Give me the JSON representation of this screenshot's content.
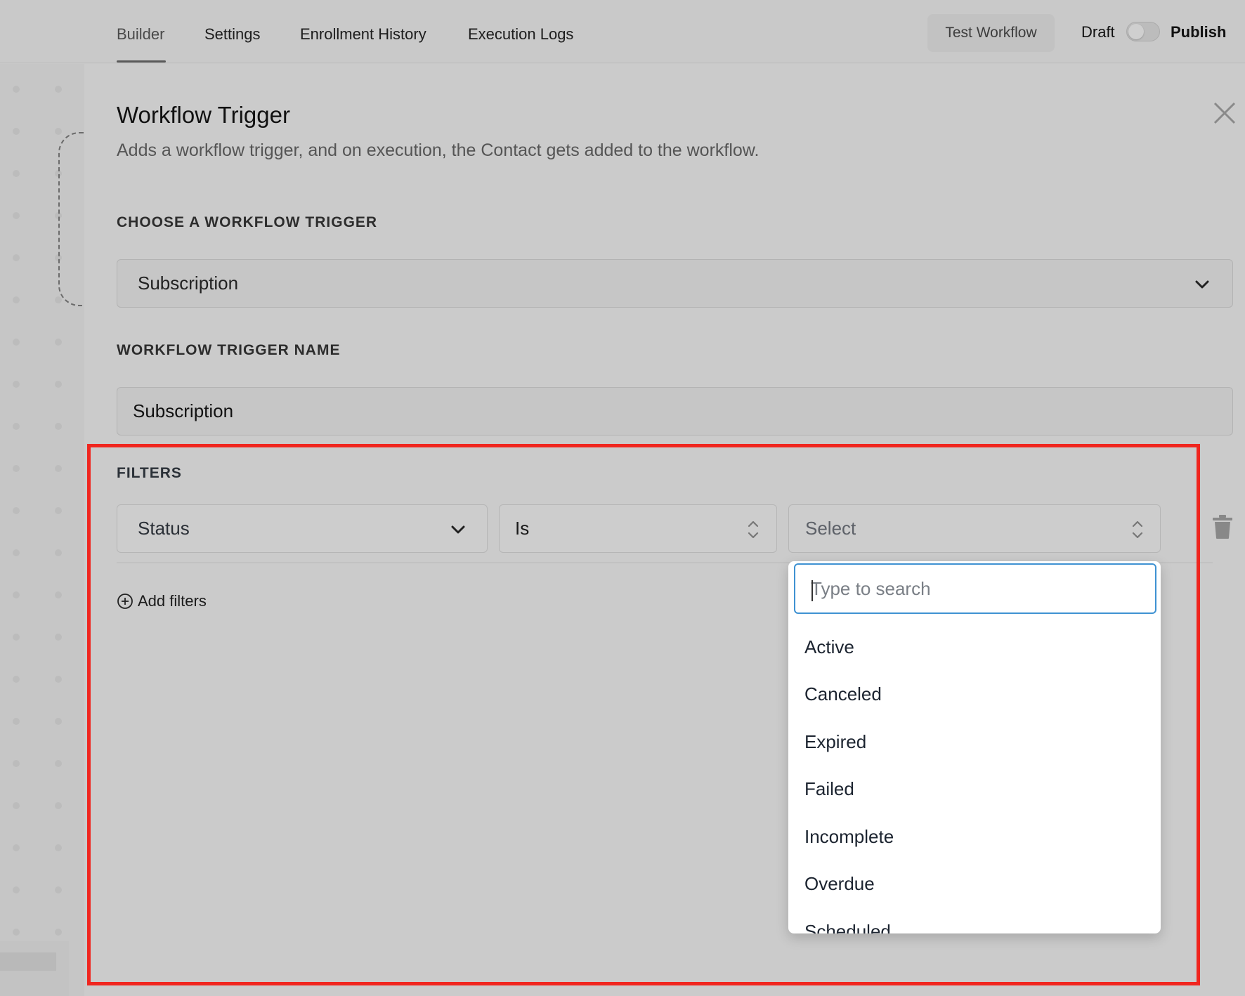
{
  "nav": {
    "tabs": [
      {
        "label": "Builder"
      },
      {
        "label": "Settings"
      },
      {
        "label": "Enrollment History"
      },
      {
        "label": "Execution Logs"
      }
    ],
    "test_button": "Test Workflow",
    "draft_label": "Draft",
    "publish_label": "Publish"
  },
  "panel": {
    "title": "Workflow Trigger",
    "subtitle": "Adds a workflow trigger, and on execution, the Contact gets added to the workflow.",
    "choose_label": "CHOOSE A WORKFLOW TRIGGER",
    "trigger_value": "Subscription",
    "name_label": "WORKFLOW TRIGGER NAME",
    "name_value": "Subscription"
  },
  "filters": {
    "label": "FILTERS",
    "field": "Status",
    "operator": "Is",
    "value_placeholder": "Select",
    "add_label": "Add filters"
  },
  "dropdown": {
    "search_placeholder": "Type to search",
    "options": [
      "Active",
      "Canceled",
      "Expired",
      "Failed",
      "Incomplete",
      "Overdue",
      "Scheduled"
    ]
  },
  "colors": {
    "highlight": "#f0261f",
    "focus": "#3f92d2"
  }
}
